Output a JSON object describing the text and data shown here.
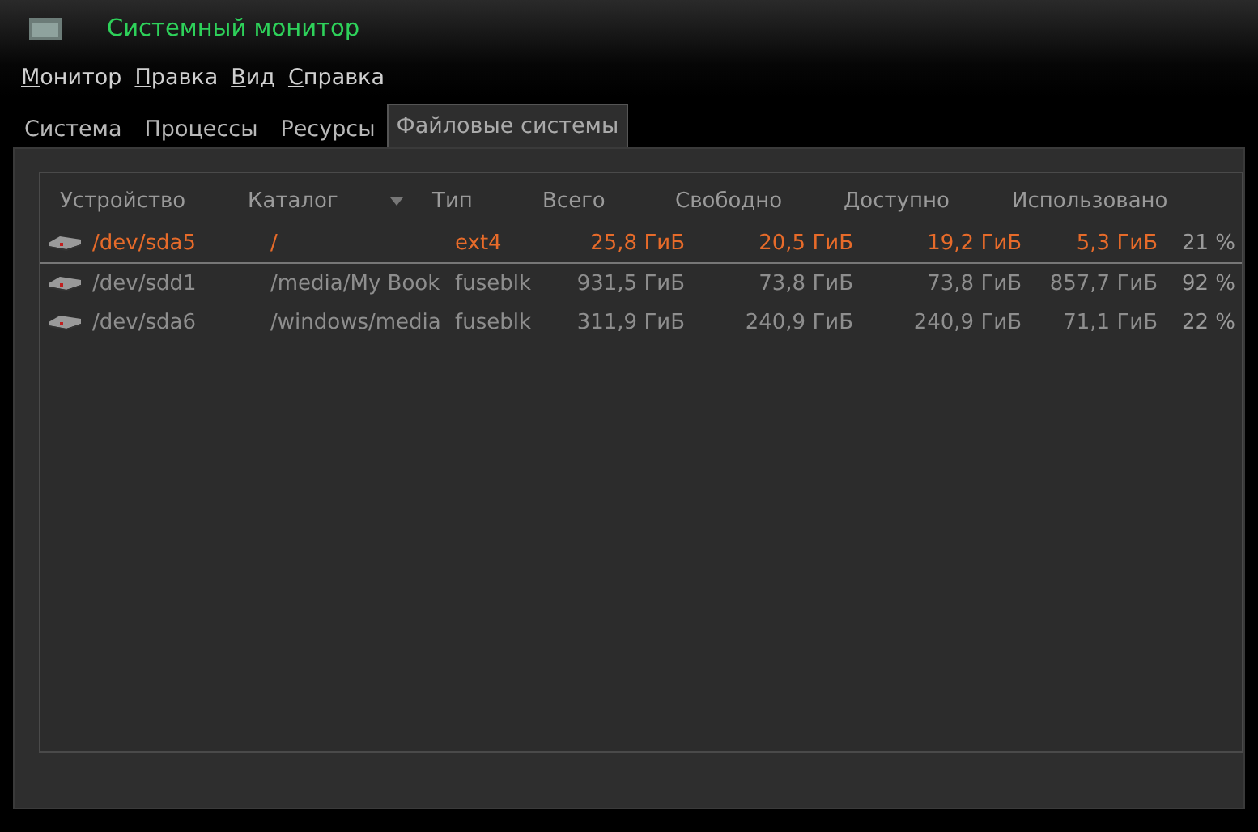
{
  "window": {
    "title": "Системный монитор"
  },
  "menu": [
    "Монитор",
    "Правка",
    "Вид",
    "Справка"
  ],
  "tabs": [
    {
      "label": "Система",
      "selected": false
    },
    {
      "label": "Процессы",
      "selected": false
    },
    {
      "label": "Ресурсы",
      "selected": false
    },
    {
      "label": "Файловые системы",
      "selected": true
    }
  ],
  "table": {
    "columns": [
      {
        "label": "Устройство",
        "sorted": false
      },
      {
        "label": "Каталог",
        "sorted": true
      },
      {
        "label": "Тип",
        "sorted": false
      },
      {
        "label": "Всего",
        "sorted": false
      },
      {
        "label": "Свободно",
        "sorted": false
      },
      {
        "label": "Доступно",
        "sorted": false
      },
      {
        "label": "Использовано",
        "sorted": false
      }
    ],
    "rows": [
      {
        "selected": true,
        "cells": [
          "/dev/sda5",
          "/",
          "ext4",
          "25,8 ГиБ",
          "20,5 ГиБ",
          "19,2 ГиБ",
          "5,3 ГиБ",
          "21 %"
        ]
      },
      {
        "selected": false,
        "cells": [
          "/dev/sdd1",
          "/media/My Book",
          "fuseblk",
          "931,5 ГиБ",
          "73,8 ГиБ",
          "73,8 ГиБ",
          "857,7 ГиБ",
          "92 %"
        ]
      },
      {
        "selected": false,
        "cells": [
          "/dev/sda6",
          "/windows/media",
          "fuseblk",
          "311,9 ГиБ",
          "240,9 ГиБ",
          "240,9 ГиБ",
          "71,1 ГиБ",
          "22 %"
        ]
      }
    ]
  }
}
